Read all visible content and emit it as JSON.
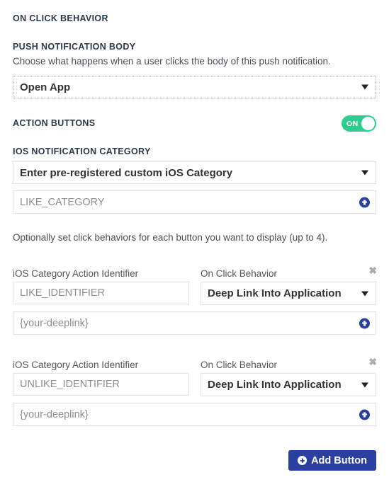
{
  "colors": {
    "accent_blue": "#2a3fa0",
    "toggle_on_green": "#2ecc8f",
    "heading_navy": "#2b3a4a",
    "border_grey": "#e2e4e7",
    "placeholder_grey": "#8a8f94"
  },
  "sections": {
    "on_click_behavior_heading": "ON CLICK BEHAVIOR",
    "push_notification_body": {
      "heading": "PUSH NOTIFICATION BODY",
      "description": "Choose what happens when a user clicks the body of this push notification.",
      "select_value": "Open App"
    },
    "action_buttons": {
      "heading": "ACTION BUTTONS",
      "toggle_state": "ON",
      "toggle_on": true
    },
    "ios_notification_category": {
      "heading": "IOS NOTIFICATION CATEGORY",
      "select_value": "Enter pre-registered custom iOS Category",
      "category_input_value": "LIKE_CATEGORY"
    },
    "helper_text": "Optionally set click behaviors for each button you want to display (up to 4)."
  },
  "action_rows": [
    {
      "identifier_label": "iOS Category Action Identifier",
      "identifier_value": "LIKE_IDENTIFIER",
      "behavior_label": "On Click Behavior",
      "behavior_value": "Deep Link Into Application",
      "deeplink_value": "{your-deeplink}",
      "close_glyph": "✖"
    },
    {
      "identifier_label": "iOS Category Action Identifier",
      "identifier_value": "UNLIKE_IDENTIFIER",
      "behavior_label": "On Click Behavior",
      "behavior_value": "Deep Link Into Application",
      "deeplink_value": "{your-deeplink}",
      "close_glyph": "✖"
    }
  ],
  "footer": {
    "add_button_label": "Add Button"
  }
}
